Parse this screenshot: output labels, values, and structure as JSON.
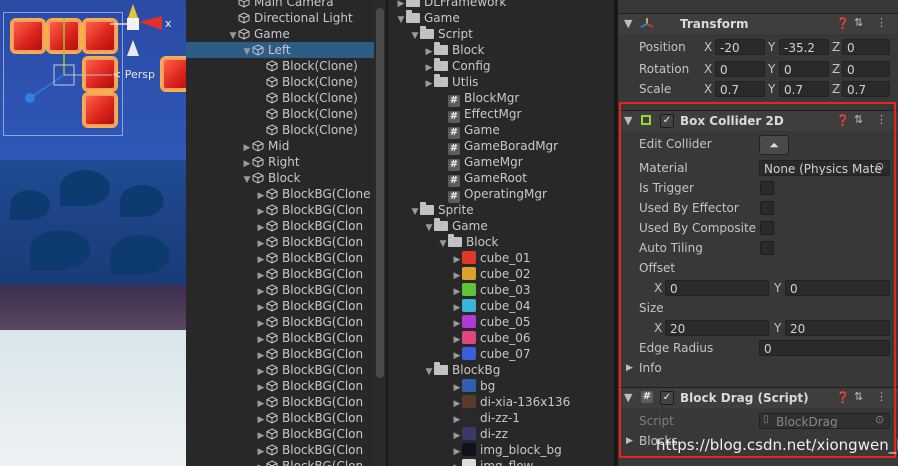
{
  "scene": {
    "persp_label": "< Persp",
    "axis_x": "x"
  },
  "hierarchy": {
    "items": [
      {
        "label": "Main Camera",
        "indent": 4,
        "arrow": false
      },
      {
        "label": "Directional Light",
        "indent": 4,
        "arrow": false
      },
      {
        "label": "Game",
        "indent": 4,
        "arrow": true,
        "open": true
      },
      {
        "label": "Left",
        "indent": 18,
        "arrow": true,
        "open": true,
        "selected": true
      },
      {
        "label": "Block(Clone)",
        "indent": 32,
        "arrow": false
      },
      {
        "label": "Block(Clone)",
        "indent": 32,
        "arrow": false
      },
      {
        "label": "Block(Clone)",
        "indent": 32,
        "arrow": false
      },
      {
        "label": "Block(Clone)",
        "indent": 32,
        "arrow": false
      },
      {
        "label": "Block(Clone)",
        "indent": 32,
        "arrow": false
      },
      {
        "label": "Mid",
        "indent": 18,
        "arrow": true,
        "open": false
      },
      {
        "label": "Right",
        "indent": 18,
        "arrow": true,
        "open": false
      },
      {
        "label": "Block",
        "indent": 18,
        "arrow": true,
        "open": true
      },
      {
        "label": "BlockBG(Clone",
        "indent": 32,
        "arrow": true,
        "open": false
      },
      {
        "label": "BlockBG(Clon",
        "indent": 32,
        "arrow": true,
        "open": false
      },
      {
        "label": "BlockBG(Clon",
        "indent": 32,
        "arrow": true,
        "open": false
      },
      {
        "label": "BlockBG(Clon",
        "indent": 32,
        "arrow": true,
        "open": false
      },
      {
        "label": "BlockBG(Clon",
        "indent": 32,
        "arrow": true,
        "open": false
      },
      {
        "label": "BlockBG(Clon",
        "indent": 32,
        "arrow": true,
        "open": false
      },
      {
        "label": "BlockBG(Clon",
        "indent": 32,
        "arrow": true,
        "open": false
      },
      {
        "label": "BlockBG(Clon",
        "indent": 32,
        "arrow": true,
        "open": false
      },
      {
        "label": "BlockBG(Clon",
        "indent": 32,
        "arrow": true,
        "open": false
      },
      {
        "label": "BlockBG(Clon",
        "indent": 32,
        "arrow": true,
        "open": false
      },
      {
        "label": "BlockBG(Clon",
        "indent": 32,
        "arrow": true,
        "open": false
      },
      {
        "label": "BlockBG(Clon",
        "indent": 32,
        "arrow": true,
        "open": false
      },
      {
        "label": "BlockBG(Clon",
        "indent": 32,
        "arrow": true,
        "open": false
      },
      {
        "label": "BlockBG(Clon",
        "indent": 32,
        "arrow": true,
        "open": false
      },
      {
        "label": "BlockBG(Clon",
        "indent": 32,
        "arrow": true,
        "open": false
      },
      {
        "label": "BlockBG(Clon",
        "indent": 32,
        "arrow": true,
        "open": false
      },
      {
        "label": "BlockBG(Clon",
        "indent": 32,
        "arrow": true,
        "open": false
      },
      {
        "label": "BlockBG(Clon",
        "indent": 32,
        "arrow": true,
        "open": false
      }
    ]
  },
  "project": {
    "items": [
      {
        "label": "DLFramework",
        "indent": 18,
        "kind": "folder",
        "arrow": "right"
      },
      {
        "label": "Game",
        "indent": 18,
        "kind": "folder",
        "arrow": "down"
      },
      {
        "label": "Script",
        "indent": 32,
        "kind": "folder",
        "arrow": "down"
      },
      {
        "label": "Block",
        "indent": 46,
        "kind": "folder",
        "arrow": "right"
      },
      {
        "label": "Config",
        "indent": 46,
        "kind": "folder",
        "arrow": "right"
      },
      {
        "label": "Utlis",
        "indent": 46,
        "kind": "folder",
        "arrow": "right"
      },
      {
        "label": "BlockMgr",
        "indent": 60,
        "kind": "script",
        "arrow": ""
      },
      {
        "label": "EffectMgr",
        "indent": 60,
        "kind": "script",
        "arrow": ""
      },
      {
        "label": "Game",
        "indent": 60,
        "kind": "script",
        "arrow": ""
      },
      {
        "label": "GameBoradMgr",
        "indent": 60,
        "kind": "script",
        "arrow": ""
      },
      {
        "label": "GameMgr",
        "indent": 60,
        "kind": "script",
        "arrow": ""
      },
      {
        "label": "GameRoot",
        "indent": 60,
        "kind": "script",
        "arrow": ""
      },
      {
        "label": "OperatingMgr",
        "indent": 60,
        "kind": "script",
        "arrow": ""
      },
      {
        "label": "Sprite",
        "indent": 32,
        "kind": "folder",
        "arrow": "down"
      },
      {
        "label": "Game",
        "indent": 46,
        "kind": "folder",
        "arrow": "down"
      },
      {
        "label": "Block",
        "indent": 60,
        "kind": "folder",
        "arrow": "down"
      },
      {
        "label": "cube_01",
        "indent": 74,
        "kind": "sprite",
        "arrow": "right",
        "color": "#e0392c"
      },
      {
        "label": "cube_02",
        "indent": 74,
        "kind": "sprite",
        "arrow": "right",
        "color": "#e0a12c"
      },
      {
        "label": "cube_03",
        "indent": 74,
        "kind": "sprite",
        "arrow": "right",
        "color": "#5fc238"
      },
      {
        "label": "cube_04",
        "indent": 74,
        "kind": "sprite",
        "arrow": "right",
        "color": "#3ab3d8"
      },
      {
        "label": "cube_05",
        "indent": 74,
        "kind": "sprite",
        "arrow": "right",
        "color": "#b03ad8"
      },
      {
        "label": "cube_06",
        "indent": 74,
        "kind": "sprite",
        "arrow": "right",
        "color": "#e0467e"
      },
      {
        "label": "cube_07",
        "indent": 74,
        "kind": "sprite",
        "arrow": "right",
        "color": "#3a5fd8"
      },
      {
        "label": "BlockBg",
        "indent": 46,
        "kind": "folder",
        "arrow": "down"
      },
      {
        "label": "bg",
        "indent": 74,
        "kind": "sprite",
        "arrow": "right",
        "color": "#2e5fb0"
      },
      {
        "label": "di-xia-136x136",
        "indent": 74,
        "kind": "sprite",
        "arrow": "right",
        "color": "#5a3a2a"
      },
      {
        "label": "di-zz-1",
        "indent": 74,
        "kind": "sprite",
        "arrow": "right",
        "color": "#2a2a2a"
      },
      {
        "label": "di-zz",
        "indent": 74,
        "kind": "sprite",
        "arrow": "right",
        "color": "#3a3a6a"
      },
      {
        "label": "img_block_bg",
        "indent": 74,
        "kind": "sprite",
        "arrow": "right",
        "color": "#101020"
      },
      {
        "label": "img_flow",
        "indent": 74,
        "kind": "sprite",
        "arrow": "right",
        "color": "#dddddd"
      }
    ]
  },
  "inspector": {
    "transform": {
      "title": "Transform",
      "position_label": "Position",
      "rotation_label": "Rotation",
      "scale_label": "Scale",
      "axis_x": "X",
      "axis_y": "Y",
      "axis_z": "Z",
      "position": {
        "x": "-20",
        "y": "-35.2",
        "z": "0"
      },
      "rotation": {
        "x": "0",
        "y": "0",
        "z": "0"
      },
      "scale": {
        "x": "0.7",
        "y": "0.7",
        "z": "0.7"
      }
    },
    "box_collider": {
      "title": "Box Collider 2D",
      "edit_collider_label": "Edit Collider",
      "material_label": "Material",
      "material_value": "None (Physics Mate",
      "is_trigger_label": "Is Trigger",
      "used_by_effector_label": "Used By Effector",
      "used_by_composite_label": "Used By Composite",
      "auto_tiling_label": "Auto Tiling",
      "offset_label": "Offset",
      "offset": {
        "x": "0",
        "y": "0"
      },
      "size_label": "Size",
      "size": {
        "x": "20",
        "y": "20"
      },
      "edge_radius_label": "Edge Radius",
      "edge_radius_value": "0",
      "info_label": "Info",
      "axis_x": "X",
      "axis_y": "Y"
    },
    "block_drag": {
      "title": "Block Drag (Script)",
      "script_label": "Script",
      "script_value": "BlockDrag",
      "blocks_label": "Blocks"
    }
  },
  "watermark": "https://blog.csdn.net/xiongwen_li",
  "colors": {
    "highlight_border": "#e8241b",
    "selection": "#2c5d87"
  }
}
